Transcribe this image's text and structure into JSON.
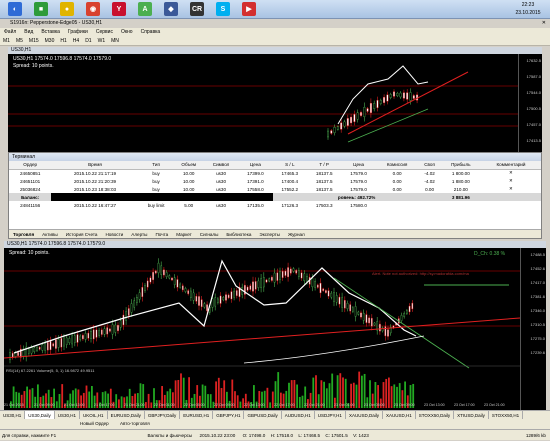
{
  "taskbar": {
    "apps": [
      {
        "icon": "app-icon-blue",
        "color": "#2f6bd6",
        "glyph": "◐"
      },
      {
        "icon": "app-icon-green",
        "color": "#2e9b3a",
        "glyph": "■"
      },
      {
        "icon": "app-icon-yellow",
        "color": "#e0b400",
        "glyph": "●"
      },
      {
        "icon": "app-icon-chrome",
        "color": "#d8412f",
        "glyph": "◉"
      },
      {
        "icon": "app-icon-y",
        "color": "#c8102e",
        "glyph": "Y"
      },
      {
        "icon": "app-icon-a",
        "color": "#4caf50",
        "glyph": "A"
      },
      {
        "icon": "app-icon-s",
        "color": "#3b5998",
        "glyph": "◆"
      },
      {
        "icon": "app-icon-cr",
        "color": "#333333",
        "glyph": "CR"
      },
      {
        "icon": "app-icon-skype",
        "color": "#00aff0",
        "glyph": "S"
      },
      {
        "icon": "app-icon-red",
        "color": "#d32f2f",
        "glyph": "▶"
      }
    ],
    "clock": {
      "time": "22:23",
      "day": "Пятница",
      "date": "23.10.2015"
    }
  },
  "window": {
    "title": "S1916n: Pepperstone-Edge05 - US30,H1"
  },
  "menu": [
    "Файл",
    "Вид",
    "Вставка",
    "Графики",
    "Сервис",
    "Окно",
    "Справка"
  ],
  "timeframes": [
    "M1",
    "M5",
    "M15",
    "M30",
    "H1",
    "H4",
    "D1",
    "W1",
    "MN"
  ],
  "top_chart": {
    "title": "US30,H1",
    "header": "US30,H1 17574.0 17596.8 17574.0 17579.0",
    "spread": "Spread: 10 points.",
    "prices": [
      "17632.5",
      "17587.0",
      "17544.0",
      "17500.5",
      "17457.0",
      "17413.5"
    ]
  },
  "terminal": {
    "title": "Терминал",
    "columns": [
      "Ордер",
      "Время",
      "Тип",
      "Объем",
      "Символ",
      "Цена",
      "S / L",
      "T / P",
      "Цена",
      "Комиссия",
      "Своп",
      "Прибыль",
      "Комментарий"
    ],
    "rows": [
      [
        "24650851",
        "2015.10.22 21:17:19",
        "buy",
        "10.00",
        "us30",
        "17399.0",
        "17465.3",
        "18137.5",
        "17579.0",
        "0.00",
        "-4.02",
        "1 800.00"
      ],
      [
        "24651101",
        "2015.10.22 21:20:39",
        "buy",
        "10.00",
        "us30",
        "17391.0",
        "17400.4",
        "18137.5",
        "17579.0",
        "0.00",
        "-4.02",
        "1 880.00"
      ],
      [
        "25036824",
        "2015.10.23 18:38:03",
        "buy",
        "10.00",
        "us30",
        "17558.0",
        "17552.2",
        "18137.5",
        "17579.0",
        "0.00",
        "0.00",
        "210.00"
      ]
    ],
    "balance_label": "Баланс:",
    "balance_level": "ровень: 492.72%",
    "balance_total": "3 881.96",
    "pending": [
      "24841156",
      "2015.10.22 16:47:27",
      "buy limit",
      "5.00",
      "us30",
      "17135.0",
      "17126.3",
      "17503.3",
      "17580.0"
    ],
    "tabs": [
      "Торговля",
      "Активы",
      "История Счета",
      "Новости",
      "Алерты",
      "Почта",
      "Маркет",
      "Сигналы",
      "Библиотека",
      "Эксперты",
      "Журнал"
    ],
    "mail_badge": "3",
    "market_badge": "67"
  },
  "bottom_chart": {
    "header": "US30,H1 17574.0 17596.8 17574.0 17579.0",
    "spread": "Spread: 10 points.",
    "dd": "D_Ch: 0.38 %",
    "note": "Alert. Note not authorized: http://sy.madorafda.com/ma",
    "rsi": "RSI(14) 67.2261  Volume(5, 5, 1) 16.9872 49.9511",
    "prices": [
      "17488.5",
      "17452.6",
      "17417.0",
      "17381.6",
      "17346.0",
      "17310.5",
      "17275.0",
      "17239.6"
    ],
    "dates": [
      "21 Oct 2015",
      "21 Oct 09:00",
      "21 Oct 13:00",
      "21 Oct 17:00",
      "21 Oct 21:00",
      "22 Oct 01:00",
      "22 Oct 05:00",
      "22 Oct 09:00",
      "22 Oct 13:00",
      "22 Oct 17:00",
      "22 Oct 21:00",
      "23 Oct 01:00",
      "23 Oct 05:00",
      "23 Oct 09:00",
      "23 Oct 13:00",
      "23 Oct 17:00",
      "23 Oct 21:00"
    ]
  },
  "symbol_tabs": [
    "US30,H1",
    "US30,Daily",
    "US30,H1",
    "UKOIL,H1",
    "EURUSD,Daily",
    "GBPJPY,Daily",
    "EURUSD,H1",
    "GBPJPY,H1",
    "GBPUSD,Daily",
    "AUDUSD,H1",
    "USDJPY,H1",
    "XAUUSD,Daily",
    "XAUUSD,H1",
    "STOXX50,Daily",
    "XTIUSD,Daily",
    "STOXX50,H1",
    "XTIUSD,H1"
  ],
  "toolbar2": [
    "Новый Ордер",
    "Авто-торговля"
  ],
  "status": {
    "help": "Для справки, нажмите F1",
    "profile": "Default",
    "bar": "Валюты и фьючерсы",
    "time": "2015.10.22 23:00",
    "o": "O: 17498.0",
    "h": "H: 17518.0",
    "l": "L: 17468.5",
    "c": "C: 17501.5",
    "v": "V: 1423",
    "traffic": "1289/6 kb"
  },
  "colors": {
    "chart_bg": "#000000",
    "line_white": "#ffffff",
    "line_red": "#e02020",
    "line_green": "#4caf50"
  }
}
